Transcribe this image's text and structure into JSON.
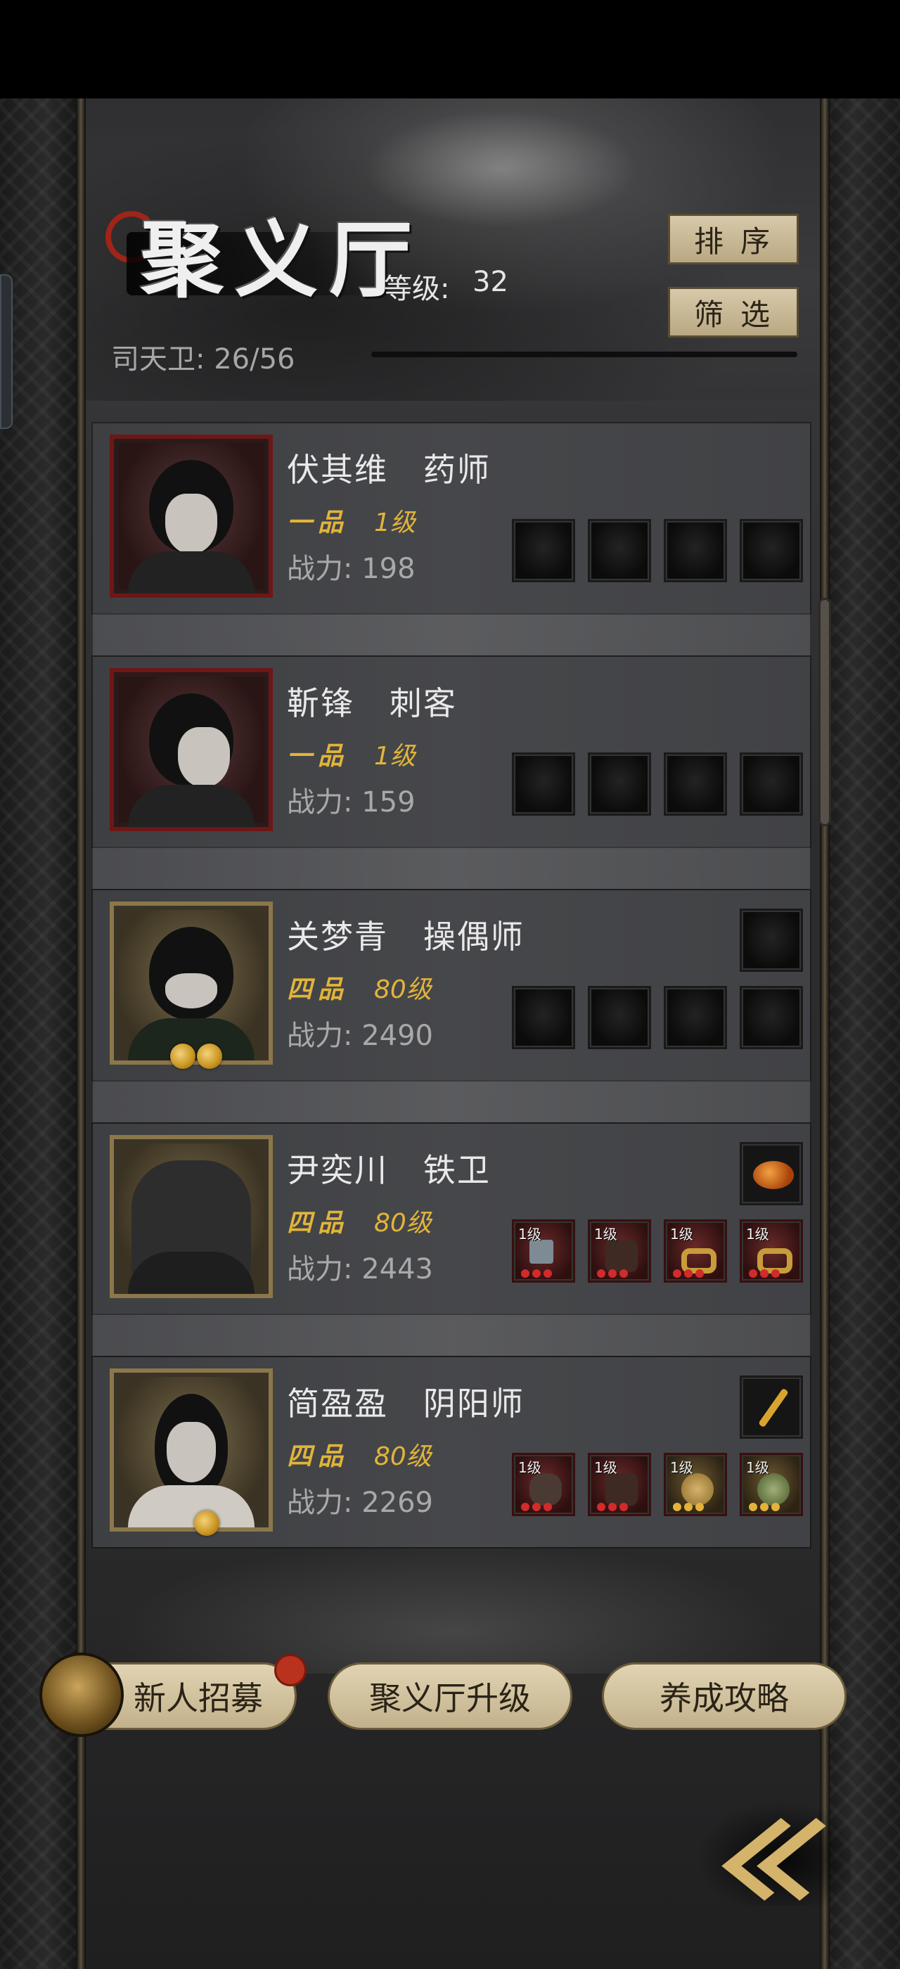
{
  "header": {
    "title": "聚义厅",
    "level_label": "等级:",
    "level_value": "32",
    "guard_count": "司天卫: 26/56",
    "sort_button": "排序",
    "filter_button": "筛选"
  },
  "members": [
    {
      "name": "伏其维   药师",
      "grade": "一品",
      "level": "1级",
      "power": "战力: 198",
      "frame": "red",
      "badges": 0
    },
    {
      "name": "靳锋   刺客",
      "grade": "一品",
      "level": "1级",
      "power": "战力: 159",
      "frame": "red",
      "badges": 0
    },
    {
      "name": "关梦青   操偶师",
      "grade": "四品",
      "level": "80级",
      "power": "战力: 2490",
      "frame": "gold",
      "badges": 2
    },
    {
      "name": "尹奕川   铁卫",
      "grade": "四品",
      "level": "80级",
      "power": "战力: 2443",
      "frame": "gold",
      "badges": 0,
      "equip_levels": [
        "1级",
        "1级",
        "1级",
        "1级"
      ]
    },
    {
      "name": "简盈盈   阴阳师",
      "grade": "四品",
      "level": "80级",
      "power": "战力: 2269",
      "frame": "gold",
      "badges": 1,
      "equip_levels": [
        "1级",
        "1级",
        "1级",
        "1级"
      ]
    }
  ],
  "footer": {
    "recruit_button": "新人招募",
    "upgrade_button": "聚义厅升级",
    "guide_button": "养成攻略"
  },
  "icons": [
    "back-double-chevron-icon",
    "recruit-token-icon",
    "notification-dot-icon"
  ],
  "colors": {
    "gold_text": "#e1b43a",
    "button_bg": "#d7c9aa",
    "red_frame": "#6d1717"
  }
}
